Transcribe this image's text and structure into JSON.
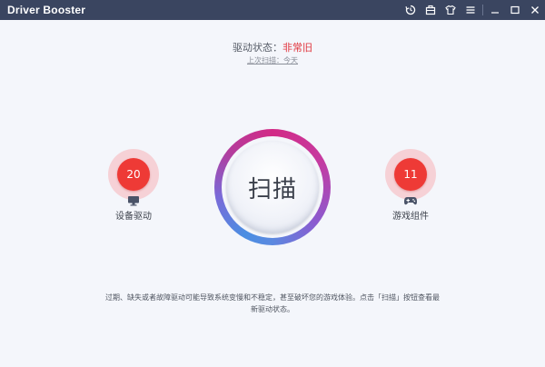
{
  "app": {
    "title": "Driver Booster"
  },
  "titlebar": {
    "icons": [
      "history-icon",
      "toolbox-icon",
      "shirt-icon",
      "menu-icon",
      "minimize-icon",
      "maximize-icon",
      "close-icon"
    ]
  },
  "status": {
    "label": "驱动状态：",
    "value": "非常旧",
    "last_scan": "上次扫描：今天"
  },
  "scan_button": {
    "label": "扫描"
  },
  "device_drivers": {
    "count": "20",
    "label": "设备驱动",
    "icon": "monitor-icon"
  },
  "game_components": {
    "count": "11",
    "label": "游戏组件",
    "icon": "gamepad-icon"
  },
  "description": "过期、缺失或者故障驱动可能导致系统变慢和不稳定，甚至破坏您的游戏体验。点击「扫描」按钮查看最新驱动状态。",
  "colors": {
    "titlebar": "#3a4560",
    "status_red": "#e0333b",
    "badge_red": "#ee3a36",
    "ring_magenta": "#d22a86",
    "ring_blue": "#4a8ee2"
  }
}
